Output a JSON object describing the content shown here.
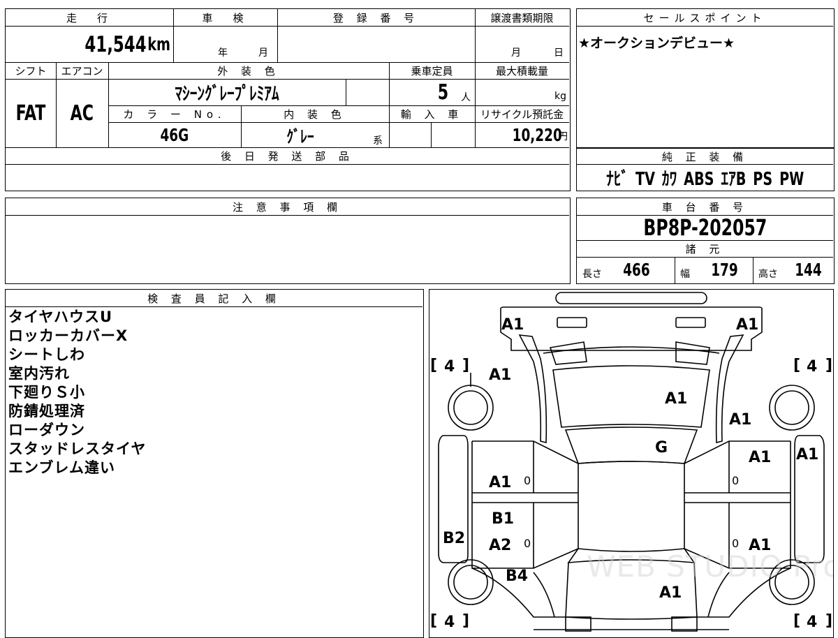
{
  "sheet": {
    "mileage": {
      "header": "走　行",
      "value": "41,544",
      "unit": "km"
    },
    "inspection": {
      "header": "車　検",
      "year_label": "年",
      "month_label": "月"
    },
    "registration": {
      "header": "登 録 番 号"
    },
    "transfer_deadline": {
      "header": "譲渡書類期限",
      "month_label": "月",
      "day_label": "日"
    },
    "shift": {
      "header": "シフト",
      "value": "FAT"
    },
    "aircon": {
      "header": "エアコン",
      "value": "AC"
    },
    "exterior_color": {
      "header": "外 装 色",
      "value": "ﾏｼｰﾝｸﾞﾚｰﾌﾟﾚﾐｱﾑ"
    },
    "capacity": {
      "header": "乗車定員",
      "value": "5",
      "unit": "人"
    },
    "max_load": {
      "header": "最大積載量",
      "unit": "kg"
    },
    "color_no": {
      "header": "カ ラ ー No.",
      "value": "46G"
    },
    "interior_color": {
      "header": "内 装 色",
      "value": "ｸﾞﾚｰ",
      "suffix": "系"
    },
    "import": {
      "header": "輸 入 車"
    },
    "recycle": {
      "header": "リサイクル預託金",
      "value": "10,220",
      "unit": "円"
    },
    "later_parts": {
      "header": "後 日 発 送 部 品"
    },
    "sales_point": {
      "header": "セールスポイント",
      "value": "★オークションデビュー★"
    },
    "equipment": {
      "header": "純 正 装 備",
      "value": "ﾅﾋﾞ TV ｶﾜ ABS ｴｱB PS PW"
    },
    "notes": {
      "header": "注 意 事 項 欄"
    },
    "chassis": {
      "header": "車 台 番 号",
      "value": "BP8P-202057"
    },
    "specs": {
      "header": "諸 元",
      "length_label": "長さ",
      "length": "466",
      "width_label": "幅",
      "width": "179",
      "height_label": "高さ",
      "height": "144"
    },
    "inspector": {
      "header": "検 査 員 記 入 欄",
      "lines": [
        "タイヤハウスU",
        "ロッカーカバーX",
        "シートしわ",
        "室内汚れ",
        "下廻りＳ小",
        "防錆処理済",
        "ローダウン",
        "スタッドレスタイヤ",
        "エンブレム違い"
      ]
    }
  },
  "diagram": {
    "tires": {
      "fl": "4",
      "fr": "4",
      "rl": "4",
      "rr": "4"
    },
    "marks": {
      "front_left": "A1",
      "front_right": "A1",
      "fender_left": "A1",
      "hood": "A1",
      "fender_right": "A1",
      "windshield": "G",
      "front_door_right": "A1",
      "pillar_right": "A1",
      "front_door_left": "A1",
      "front_door_left_zero": "0",
      "front_door_right_zero": "0",
      "rear_door_left_top": "B1",
      "rear_door_left": "A2",
      "rear_door_left_zero": "0",
      "rocker_left": "B2",
      "rear_door_right_zero": "0",
      "rear_door_right": "A1",
      "quarter_left": "B4",
      "trunk": "A1"
    },
    "watermark": "WEB STUDIO Pro"
  }
}
